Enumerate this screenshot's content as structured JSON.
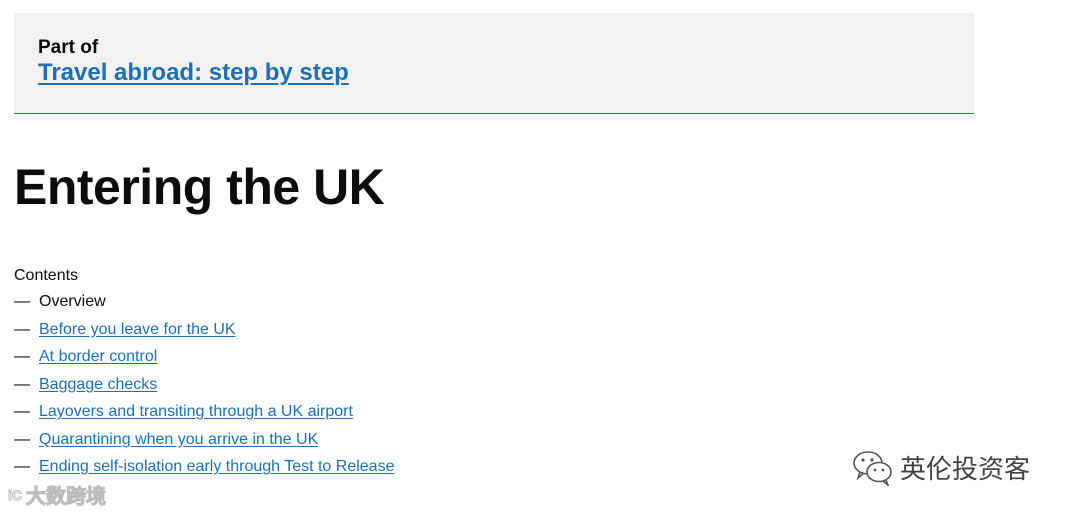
{
  "step_nav": {
    "part_of_label": "Part of",
    "link_text": "Travel abroad: step by step"
  },
  "page_title": "Entering the UK",
  "contents": {
    "heading": "Contents",
    "dash": "—",
    "current": "Overview",
    "items": [
      "Before you leave for the UK",
      "At border control",
      "Baggage checks",
      "Layovers and transiting through a UK airport",
      "Quarantining when you arrive in the UK",
      "Ending self-isolation early through Test to Release"
    ]
  },
  "watermarks": {
    "right_text": "英伦投资客",
    "right_icon": "wechat-icon",
    "left_text": "大数跨境",
    "left_logo": "iC"
  },
  "colors": {
    "link": "#1d70b8",
    "header_bg": "#f3f2f1",
    "text": "#0b0c0c"
  }
}
